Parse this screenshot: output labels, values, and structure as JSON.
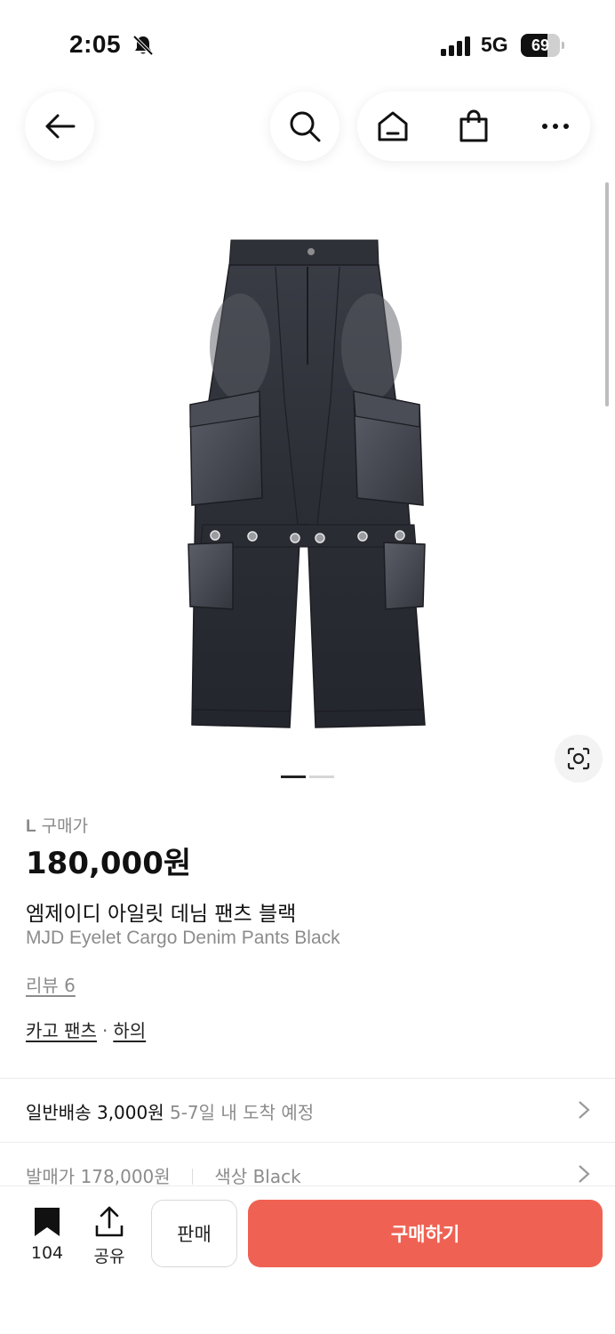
{
  "status_bar": {
    "time": "2:05",
    "network": "5G",
    "battery": "69",
    "battery_level": 0.69
  },
  "nav": {
    "icons": [
      "back-arrow-icon",
      "search-icon",
      "home-icon",
      "shopping-bag-icon",
      "more-icon"
    ]
  },
  "gallery": {
    "total_images": 2,
    "current_index": 1
  },
  "product": {
    "size": "L",
    "price_label": "구매가",
    "price": "180,000원",
    "name_ko": "엠제이디 아일릿 데님 팬츠 블랙",
    "name_en": "MJD Eyelet Cargo Denim Pants Black",
    "review": "리뷰 6",
    "category": {
      "sub": "카고 팬츠",
      "separator": "·",
      "main": "하의"
    }
  },
  "shipping": {
    "type": "일반배송",
    "fee": "3,000원",
    "eta": "5-7일 내 도착 예정"
  },
  "release": {
    "label": "발매가",
    "price": "178,000원",
    "color_label": "색상",
    "color_value": "Black"
  },
  "bottom_bar": {
    "bookmark_count": "104",
    "share_label": "공유",
    "sell_label": "판매",
    "buy_label": "구매하기"
  },
  "colors": {
    "accent": "#ef6253",
    "denim": "#2e3038"
  }
}
